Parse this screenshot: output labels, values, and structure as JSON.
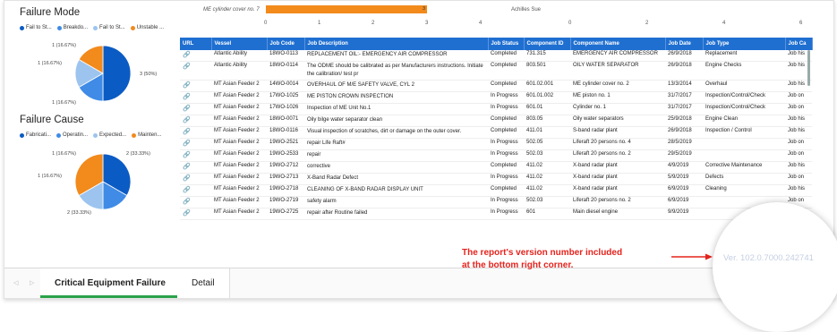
{
  "failure_mode": {
    "title": "Failure Mode",
    "legend": [
      {
        "label": "Fail to St...",
        "color": "#0b5bc4"
      },
      {
        "label": "Breakdo...",
        "color": "#3f8be6"
      },
      {
        "label": "Fail to St...",
        "color": "#9cc4ef"
      },
      {
        "label": "Unstable ...",
        "color": "#f28a1c"
      }
    ],
    "slice_labels": [
      "1 (16.67%)",
      "1 (16.67%)",
      "3 (50%)",
      "1 (16.67%)"
    ]
  },
  "failure_cause": {
    "title": "Failure Cause",
    "legend": [
      {
        "label": "Fabricati...",
        "color": "#0b5bc4"
      },
      {
        "label": "Operatin...",
        "color": "#3f8be6"
      },
      {
        "label": "Expected...",
        "color": "#9cc4ef"
      },
      {
        "label": "Mainten...",
        "color": "#f28a1c"
      }
    ],
    "slice_labels": [
      "1 (16.67%)",
      "2 (33.33%)",
      "1 (16.67%)",
      "2 (33.33%)"
    ]
  },
  "top_bar": {
    "label_left": "ME cylinder cover no. 7",
    "bar_value": "3",
    "label_right": "Achilles Sue",
    "ticks_left": [
      "0",
      "1",
      "2",
      "3",
      "4"
    ],
    "ticks_right": [
      "0",
      "2",
      "4",
      "6"
    ]
  },
  "table": {
    "columns": [
      "URL",
      "Vessel",
      "Job Code",
      "Job Description",
      "Job Status",
      "Component ID",
      "Component Name",
      "Job Date",
      "Job Type",
      "Job Ca"
    ],
    "rows": [
      [
        "🔗",
        "Atlantic Ability",
        "18WO-0113",
        "REPLACEMENT OIL:- EMERGENCY AIR COMPRESSOR",
        "Completed",
        "731.315",
        "EMERGENCY AIR COMPRESSOR",
        "26/9/2018",
        "Replacement",
        "Job his"
      ],
      [
        "🔗",
        "Atlantic Ability",
        "18WO-0114",
        "The ODME should be calibrated as per Manufacturers instructions. Initiate the calibration/ test pr",
        "Completed",
        "803.501",
        "OILY WATER SEPARATOR",
        "26/9/2018",
        "Engine Checks",
        "Job his"
      ],
      [
        "🔗",
        "MT Asian Feeder 2",
        "14WO-0014",
        "OVERHAUL OF M/E SAFETY VALVE, CYL 2",
        "Completed",
        "601.02.001",
        "ME cylinder cover no. 2",
        "13/3/2014",
        "Overhaul",
        "Job his"
      ],
      [
        "🔗",
        "MT Asian Feeder 2",
        "17WO-1025",
        "ME PISTON CROWN INSPECTION",
        "In Progress",
        "601.01.002",
        "ME piston no. 1",
        "31/7/2017",
        "Inspection/Control/Check",
        "Job on"
      ],
      [
        "🔗",
        "MT Asian Feeder 2",
        "17WO-1026",
        "Inspection of ME Unit No.1",
        "In Progress",
        "601.01",
        "Cylinder no. 1",
        "31/7/2017",
        "Inspection/Control/Check",
        "Job on"
      ],
      [
        "🔗",
        "MT Asian Feeder 2",
        "18WO-0071",
        "Oily bilge water separator clean",
        "Completed",
        "803.05",
        "Oily water separators",
        "25/9/2018",
        "Engine Clean",
        "Job his"
      ],
      [
        "🔗",
        "MT Asian Feeder 2",
        "18WO-0116",
        "Visual inspection of scratches, dirt or damage on the outer cover.",
        "Completed",
        "411.01",
        "S-band radar plant",
        "26/9/2018",
        "Inspection / Control",
        "Job his"
      ],
      [
        "🔗",
        "MT Asian Feeder 2",
        "19WO-2521",
        "repair Life Raft#",
        "In Progress",
        "502.05",
        "Liferaft 20 persons no. 4",
        "28/5/2019",
        "",
        "Job on"
      ],
      [
        "🔗",
        "MT Asian Feeder 2",
        "19WO-2533",
        "repair",
        "In Progress",
        "502.03",
        "Liferaft 20 persons no. 2",
        "29/5/2019",
        "",
        "Job on"
      ],
      [
        "🔗",
        "MT Asian Feeder 2",
        "19WO-2712",
        "corrective",
        "Completed",
        "411.02",
        "X-band radar plant",
        "4/9/2019",
        "Corrective Maintenance",
        "Job his"
      ],
      [
        "🔗",
        "MT Asian Feeder 2",
        "19WO-2713",
        "X-Band Radar Defect",
        "In Progress",
        "411.02",
        "X-band radar plant",
        "5/9/2019",
        "Defects",
        "Job on"
      ],
      [
        "🔗",
        "MT Asian Feeder 2",
        "19WO-2718",
        "CLEANING OF X-BAND RADAR DISPLAY UNIT",
        "Completed",
        "411.02",
        "X-band radar plant",
        "6/9/2019",
        "Cleaning",
        "Job his"
      ],
      [
        "🔗",
        "MT Asian Feeder 2",
        "19WO-2719",
        "safety alarm",
        "In Progress",
        "502.03",
        "Liferaft 20 persons no. 2",
        "6/9/2019",
        "",
        "Job on"
      ],
      [
        "🔗",
        "MT Asian Feeder 2",
        "19WO-2725",
        "repair after Routine failed",
        "In Progress",
        "601",
        "Main diesel engine",
        "9/9/2019",
        "",
        ""
      ]
    ]
  },
  "tabs": [
    "Critical Equipment Failure",
    "Detail"
  ],
  "annotation": {
    "line1": "The report's version number included",
    "line2": "at the bottom right corner.",
    "color": "#e5231d"
  },
  "version": "Ver. 102.0.7000.242741",
  "chart_data": [
    {
      "type": "pie",
      "title": "Failure Mode",
      "categories": [
        "Fail to St...",
        "Breakdo...",
        "Fail to St...",
        "Unstable ..."
      ],
      "values": [
        3,
        1,
        1,
        1
      ]
    },
    {
      "type": "pie",
      "title": "Failure Cause",
      "categories": [
        "Fabricati...",
        "Operatin...",
        "Expected...",
        "Mainten..."
      ],
      "values": [
        2,
        1,
        1,
        2
      ]
    },
    {
      "type": "bar",
      "categories": [
        "ME cylinder cover no. 7"
      ],
      "values": [
        3
      ],
      "xlim": [
        0,
        4
      ]
    }
  ]
}
